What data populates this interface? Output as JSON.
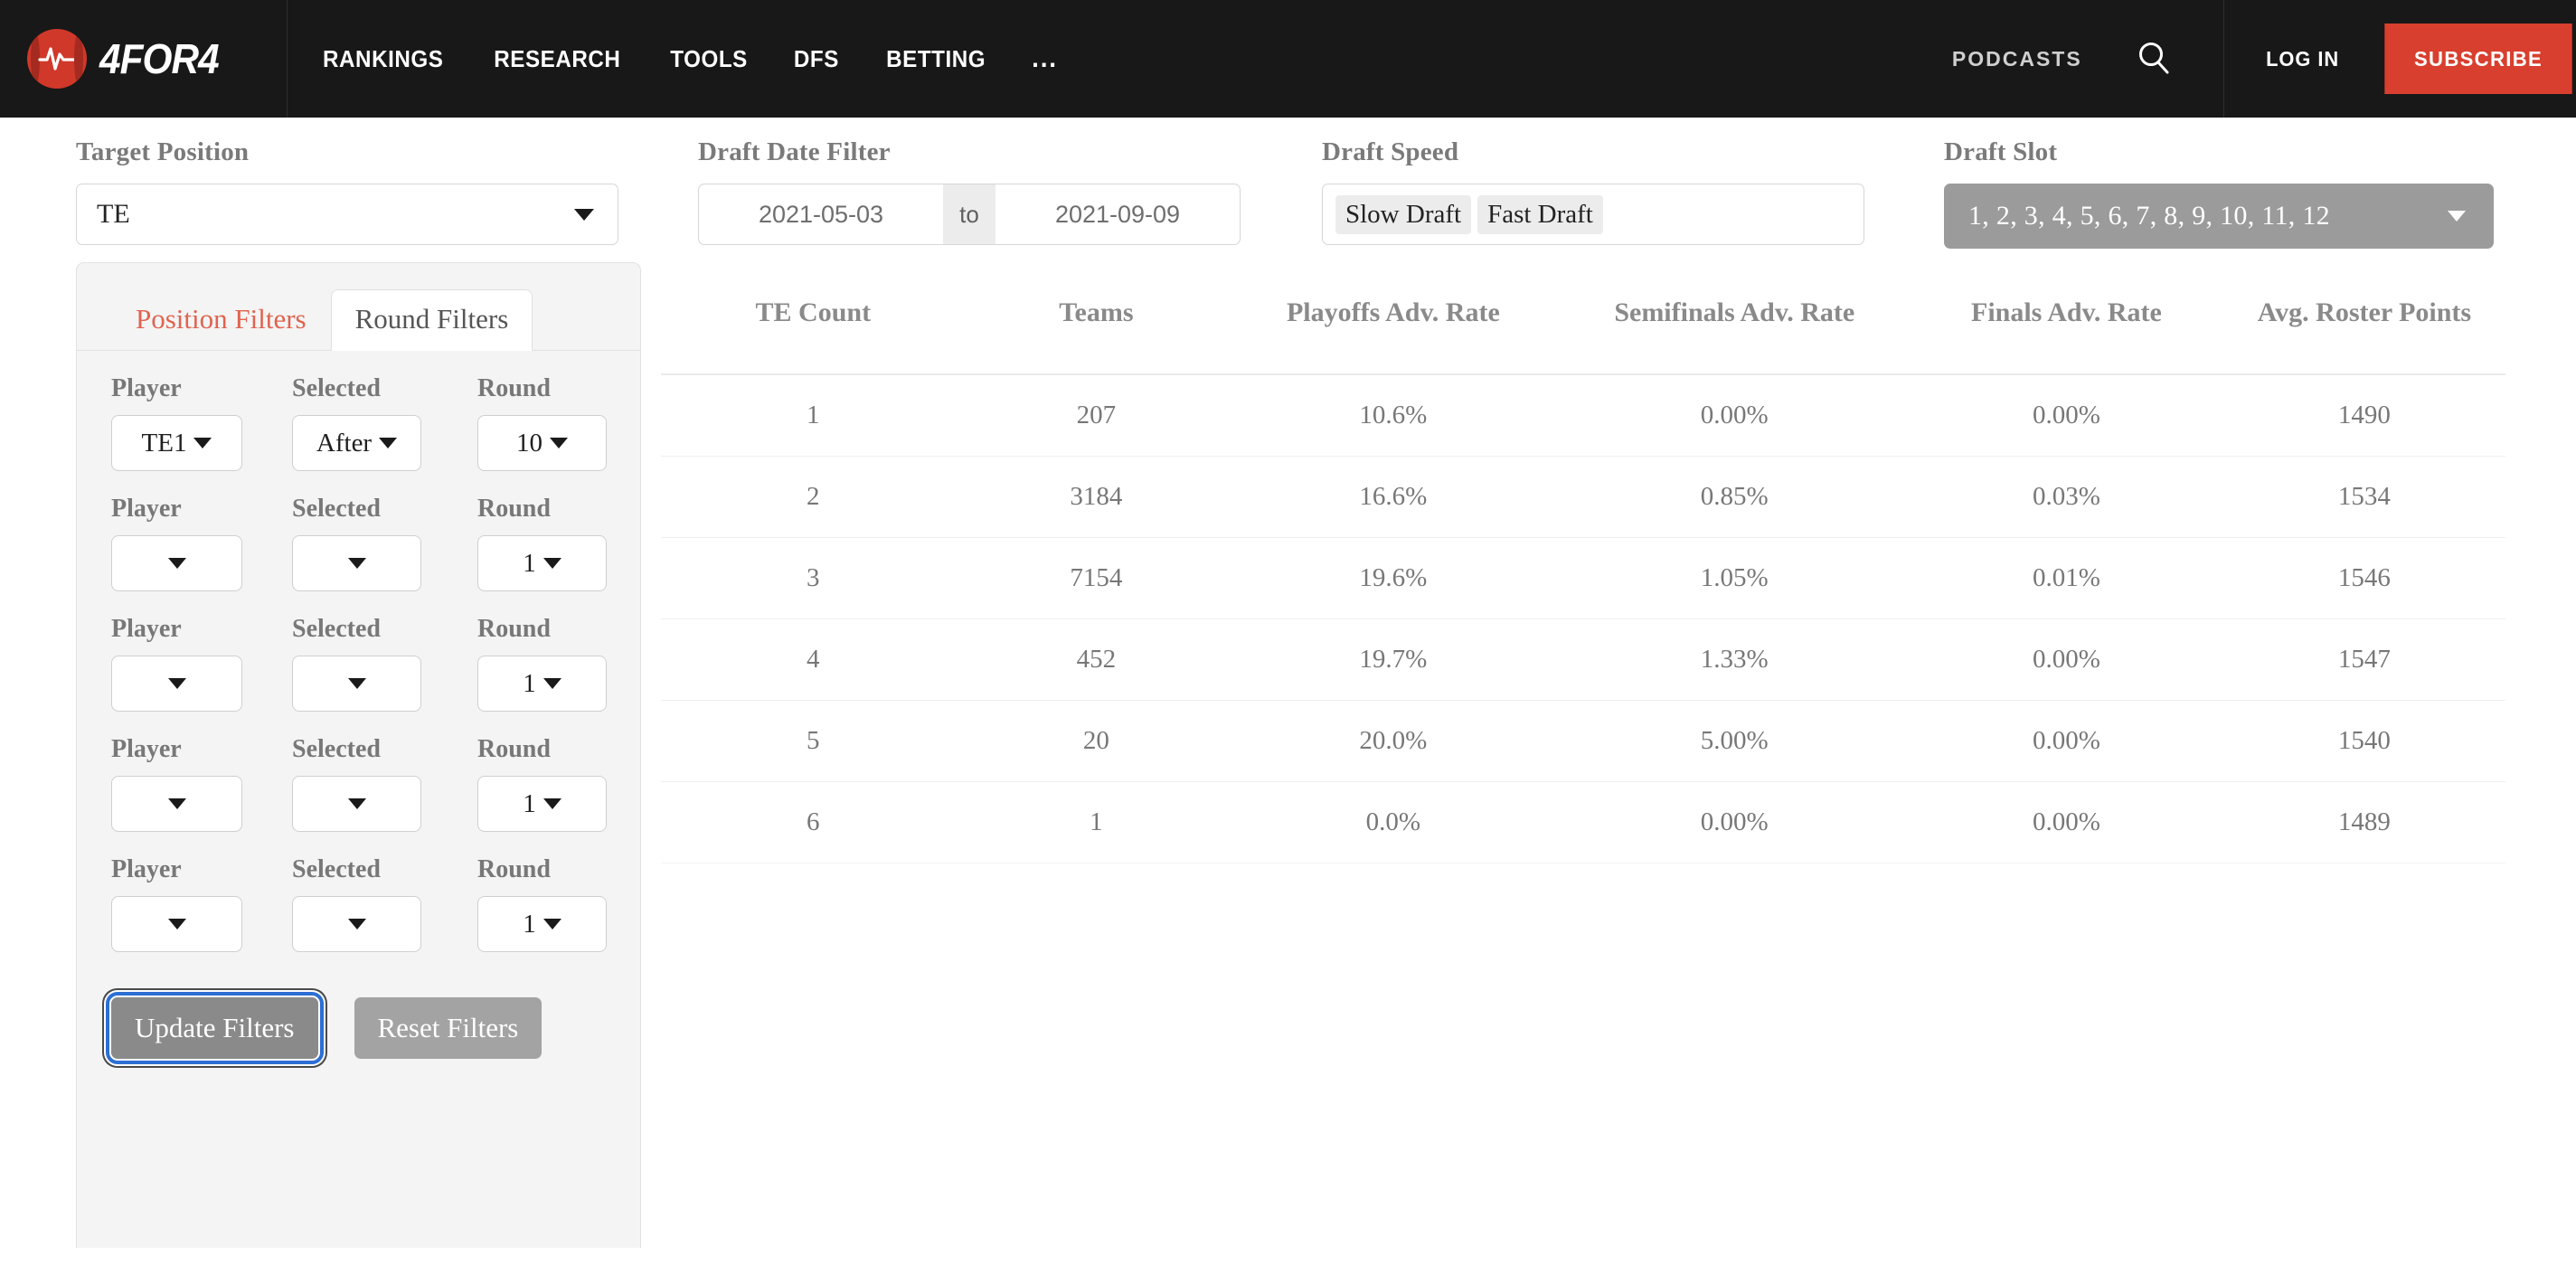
{
  "header": {
    "brand_name": "4FOR4",
    "brand_logo_icon": "heartbeat-circle-icon",
    "nav": [
      {
        "label": "RANKINGS"
      },
      {
        "label": "RESEARCH"
      },
      {
        "label": "TOOLS"
      },
      {
        "label": "DFS"
      },
      {
        "label": "BETTING"
      },
      {
        "label": "..."
      }
    ],
    "podcasts_label": "PODCASTS",
    "search_icon": "search-icon",
    "login_label": "LOG IN",
    "subscribe_label": "SUBSCRIBE",
    "colors": {
      "background": "#181818",
      "accent": "#d93f2e",
      "logo_red": "#d0382a"
    }
  },
  "filter_bar": {
    "target_position": {
      "label": "Target Position",
      "value": "TE"
    },
    "draft_date": {
      "label": "Draft Date Filter",
      "from": "2021-05-03",
      "separator": "to",
      "to": "2021-09-09"
    },
    "draft_speed": {
      "label": "Draft Speed",
      "tags": [
        "Slow Draft",
        "Fast Draft"
      ]
    },
    "draft_slot": {
      "label": "Draft Slot",
      "value": "1, 2, 3, 4, 5, 6, 7, 8, 9, 10, 11, 12"
    }
  },
  "filter_panel": {
    "tabs": [
      {
        "label": "Position Filters",
        "active": false
      },
      {
        "label": "Round Filters",
        "active": true
      }
    ],
    "column_labels": {
      "player": "Player",
      "selected": "Selected",
      "round": "Round"
    },
    "rows": [
      {
        "player": "TE1",
        "selected": "After",
        "round": "10"
      },
      {
        "player": "",
        "selected": "",
        "round": "1"
      },
      {
        "player": "",
        "selected": "",
        "round": "1"
      },
      {
        "player": "",
        "selected": "",
        "round": "1"
      },
      {
        "player": "",
        "selected": "",
        "round": "1"
      }
    ],
    "update_button": "Update Filters",
    "reset_button": "Reset Filters"
  },
  "table": {
    "columns": [
      "TE Count",
      "Teams",
      "Playoffs Adv. Rate",
      "Semifinals Adv. Rate",
      "Finals Adv. Rate",
      "Avg. Roster Points"
    ],
    "rows": [
      [
        "1",
        "207",
        "10.6%",
        "0.00%",
        "0.00%",
        "1490"
      ],
      [
        "2",
        "3184",
        "16.6%",
        "0.85%",
        "0.03%",
        "1534"
      ],
      [
        "3",
        "7154",
        "19.6%",
        "1.05%",
        "0.01%",
        "1546"
      ],
      [
        "4",
        "452",
        "19.7%",
        "1.33%",
        "0.00%",
        "1547"
      ],
      [
        "5",
        "20",
        "20.0%",
        "5.00%",
        "0.00%",
        "1540"
      ],
      [
        "6",
        "1",
        "0.0%",
        "0.00%",
        "0.00%",
        "1489"
      ]
    ]
  }
}
